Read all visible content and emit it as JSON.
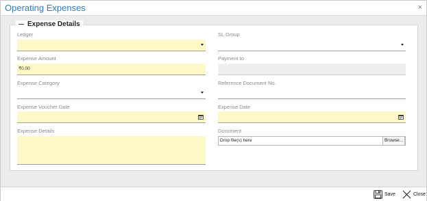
{
  "window": {
    "title": "Operating Expenses",
    "close_glyph": "×"
  },
  "section": {
    "title": "Expense Details"
  },
  "fields": {
    "ledger": {
      "label": "Ledger",
      "value": ""
    },
    "sl_group": {
      "label": "SL Group",
      "value": ""
    },
    "expense_amount": {
      "label": "Expense Amount",
      "value": "₹0.00"
    },
    "payment_to": {
      "label": "Payment to",
      "value": ""
    },
    "expense_category": {
      "label": "Expense Category",
      "value": ""
    },
    "reference_document": {
      "label": "Reference Document No.",
      "value": ""
    },
    "expense_voucher_date": {
      "label": "Expense Voucher Date",
      "value": ""
    },
    "expense_date": {
      "label": "Expense Date",
      "value": ""
    },
    "expense_details": {
      "label": "Expense Details",
      "value": ""
    },
    "document": {
      "label": "Document",
      "dropzone_text": "Drop file(s) here",
      "browse_label": "Browse..."
    }
  },
  "footer": {
    "save_label": "Save",
    "close_label": "Close"
  },
  "colors": {
    "title_blue": "#2e7bbf",
    "field_yellow": "#fdf8c6",
    "field_grey": "#efefef"
  }
}
